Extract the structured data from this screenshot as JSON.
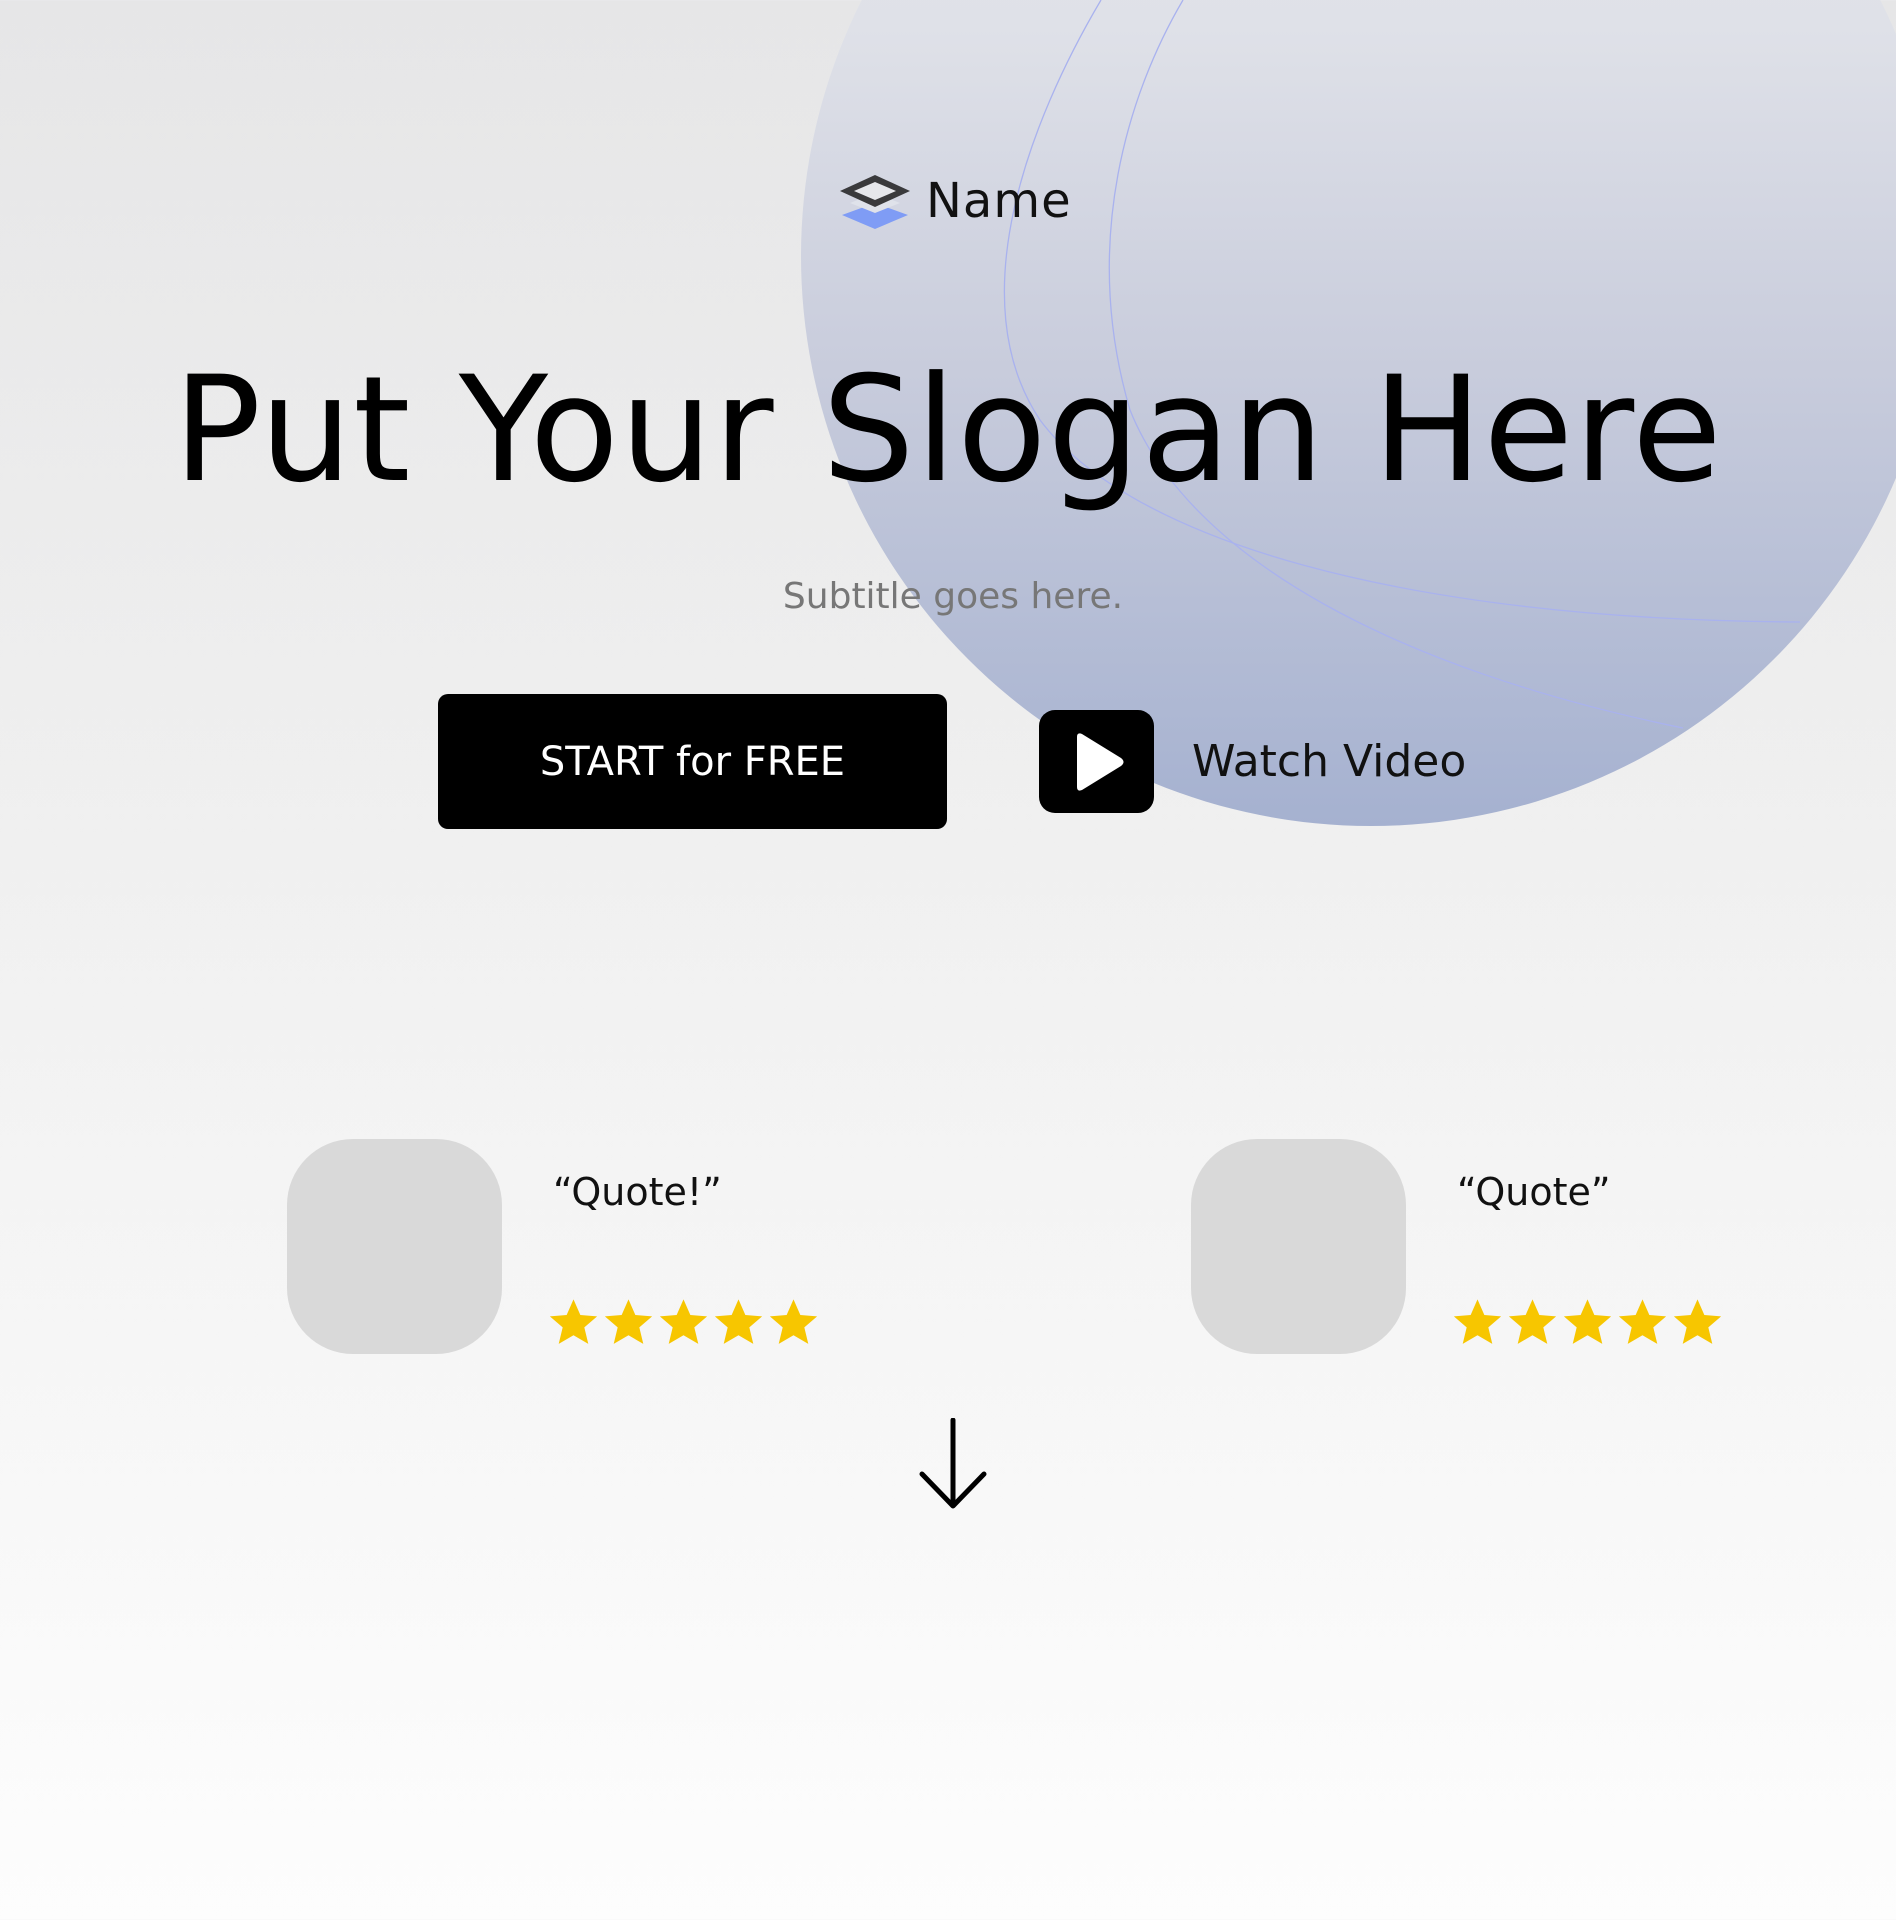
{
  "brand": {
    "name": "Name",
    "logo_icon": "layers-icon",
    "colors": {
      "logo_top": "#3a3a3c",
      "logo_bottom": "#7f9cf5"
    }
  },
  "hero": {
    "slogan": "Put Your Slogan Here",
    "subtitle": "Subtitle goes here."
  },
  "cta": {
    "start_label": "START for FREE",
    "watch_label": "Watch Video",
    "play_icon": "play-icon"
  },
  "testimonials": [
    {
      "quote": "“Quote!”",
      "rating": 5,
      "max_rating": 5
    },
    {
      "quote": "“Quote”",
      "rating": 5,
      "max_rating": 5
    }
  ],
  "scroll": {
    "icon": "arrow-down-icon"
  },
  "colors": {
    "accent_circle": "#a5b1d0",
    "star": "#f7c600",
    "button_bg": "#000000",
    "avatar_placeholder": "#d9d9d9"
  }
}
